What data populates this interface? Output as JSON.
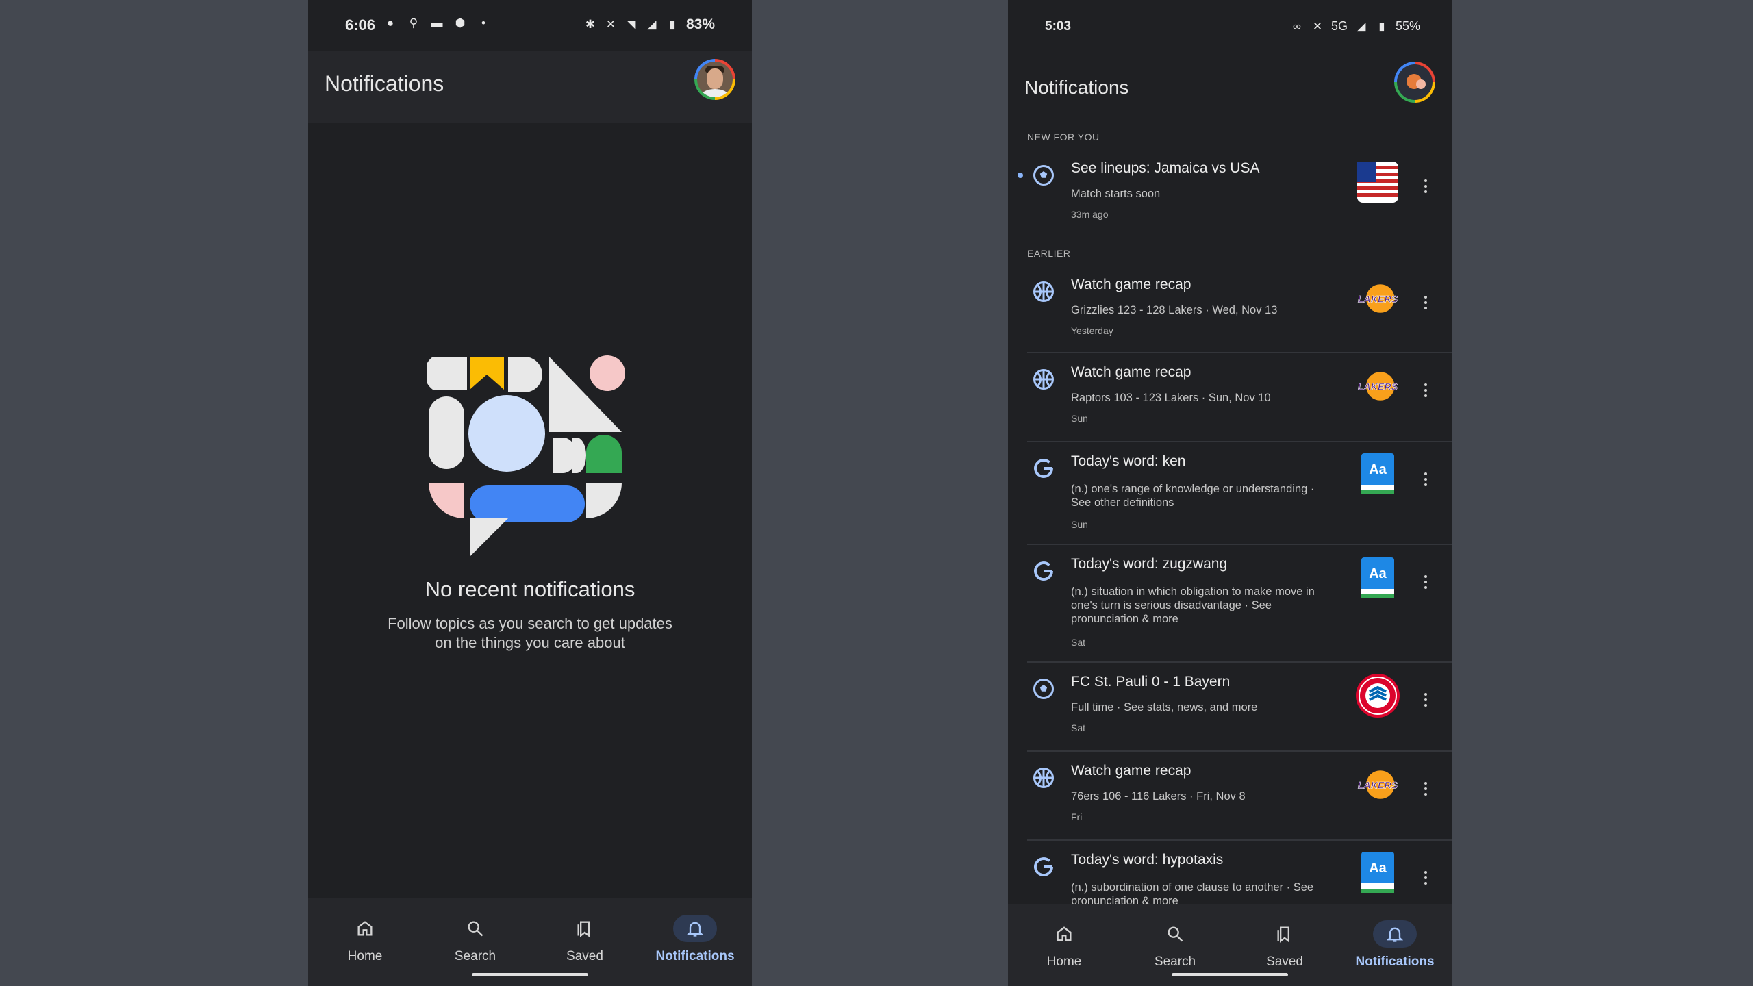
{
  "left_phone": {
    "status": {
      "time": "6:06",
      "battery": "83%"
    },
    "title": "Notifications",
    "empty_title": "No recent notifications",
    "empty_sub_line1": "Follow topics as you search to get updates",
    "empty_sub_line2": "on the things you care about"
  },
  "right_phone": {
    "status": {
      "time": "5:03",
      "network": "5G",
      "battery": "55%"
    },
    "title": "Notifications",
    "section_new": "NEW FOR YOU",
    "section_earlier": "EARLIER",
    "notifications": [
      {
        "icon": "soccer-ball-icon",
        "thumb": "usa-flag",
        "title": "See lineups: Jamaica vs USA",
        "subtitle": "Match starts soon",
        "time": "33m ago"
      },
      {
        "icon": "basketball-icon",
        "thumb": "lakers-logo",
        "title": "Watch game recap",
        "subtitle": "Grizzlies 123 - 128 Lakers · Wed, Nov 13",
        "time": "Yesterday"
      },
      {
        "icon": "basketball-icon",
        "thumb": "lakers-logo",
        "title": "Watch game recap",
        "subtitle": "Raptors 103 - 123 Lakers · Sun, Nov 10",
        "time": "Sun"
      },
      {
        "icon": "google-icon",
        "thumb": "dictionary-icon",
        "title": "Today's word: ken",
        "subtitle": "(n.) one's range of knowledge or understanding · See other definitions",
        "time": "Sun"
      },
      {
        "icon": "google-icon",
        "thumb": "dictionary-icon",
        "title": "Today's word: zugzwang",
        "subtitle": "(n.) situation in which obligation to make move in one's turn is serious disadvantage · See pronunciation & more",
        "time": "Sat"
      },
      {
        "icon": "soccer-ball-icon",
        "thumb": "bayern-logo",
        "title": "FC St. Pauli 0 - 1 Bayern",
        "subtitle": "Full time · See stats, news, and more",
        "time": "Sat"
      },
      {
        "icon": "basketball-icon",
        "thumb": "lakers-logo",
        "title": "Watch game recap",
        "subtitle": "76ers 106 - 116 Lakers · Fri, Nov 8",
        "time": "Fri"
      },
      {
        "icon": "google-icon",
        "thumb": "dictionary-icon",
        "title": "Today's word: hypotaxis",
        "subtitle": "(n.) subordination of one clause to another · See pronunciation & more",
        "time": ""
      }
    ],
    "thumb_text": {
      "lakers": "LAKERS",
      "dictionary": "Aa"
    }
  },
  "nav": {
    "home": "Home",
    "search": "Search",
    "saved": "Saved",
    "notifications": "Notifications"
  },
  "colors": {
    "accent": "#a8c7fa",
    "background": "#1f2023",
    "active_pill": "#2e3a52"
  }
}
